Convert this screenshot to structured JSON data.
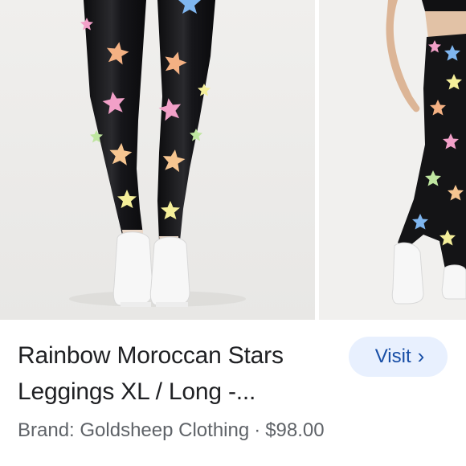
{
  "product": {
    "title": "Rainbow Moroccan Stars Leggings XL / Long -...",
    "brand_label": "Brand: Goldsheep Clothing",
    "separator": "·",
    "price": "$98.00"
  },
  "actions": {
    "visit_label": "Visit",
    "visit_icon": "chevron-right-icon",
    "visit_glyph": "›"
  },
  "images": [
    {
      "description": "black leggings with rainbow stars, front view with white sneakers"
    },
    {
      "description": "black leggings with rainbow stars, side view"
    }
  ],
  "colors": {
    "visit_bg": "#e8f0fe",
    "visit_text": "#174ea6",
    "title": "#202124",
    "meta": "#5f6368",
    "legging": "#141416"
  }
}
